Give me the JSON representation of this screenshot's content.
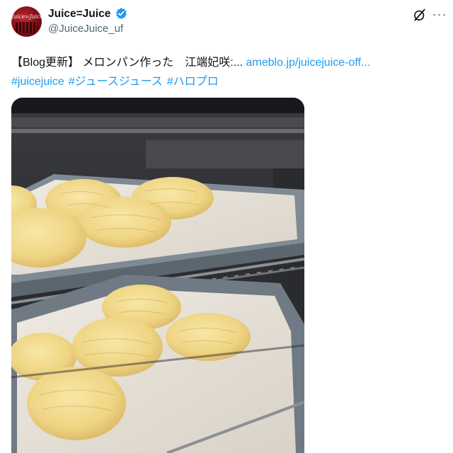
{
  "account": {
    "display_name": "Juice=Juice",
    "handle": "@JuiceJuice_uf",
    "avatar_logo": "Juice=Juice"
  },
  "post": {
    "prefix": "【Blog更新】",
    "text": " メロンパン作った　江端妃咲:... ",
    "link": "ameblo.jp/juicejuice-off...",
    "hashtags": [
      "#juicejuice",
      "#ジュースジュース",
      "#ハロプロ"
    ]
  },
  "icons": {
    "verified": "verified-badge-icon",
    "grok": "grok-icon",
    "more": "more-icon"
  },
  "colors": {
    "link": "#1d9bf0",
    "text": "#0f1419",
    "secondary": "#536471"
  }
}
